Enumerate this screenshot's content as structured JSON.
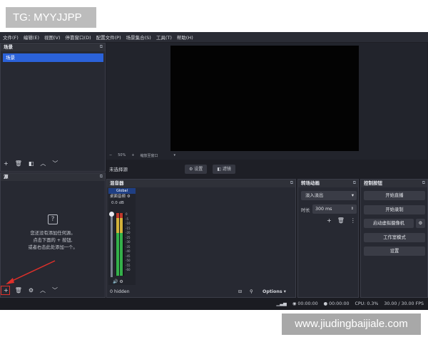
{
  "overlay": {
    "tag": "TG: MYYJJPP",
    "url": "www.jiudingbaijiale.com"
  },
  "menu": [
    "文件(F)",
    "编辑(E)",
    "视图(V)",
    "停靠窗口(D)",
    "配置文件(P)",
    "场景集合(S)",
    "工具(T)",
    "帮助(H)"
  ],
  "scenes": {
    "title": "场景",
    "items": [
      "场景"
    ]
  },
  "sources": {
    "title": "源",
    "empty_lines": [
      "您还没有添加任何源。",
      "点击下面的 + 按钮,",
      "或者右击此处添加一个。"
    ]
  },
  "preview": {
    "zoom": "50%",
    "scale_label": "缩放至窗口"
  },
  "source_bar": {
    "no_source": "未选择源",
    "settings": "设置",
    "filters": "滤镜"
  },
  "mixer": {
    "title": "混音器",
    "track": "Global",
    "channel_name": "桌面音频",
    "level": "0.0 dB",
    "scale": [
      "0",
      "-5",
      "-10",
      "-15",
      "-20",
      "-25",
      "-30",
      "-35",
      "-40",
      "-45",
      "-50",
      "-55",
      "-60"
    ],
    "hidden": "0 hidden",
    "options": "Options"
  },
  "transitions": {
    "title": "转场动画",
    "type": "淡入淡出",
    "duration_label": "时长",
    "duration": "300 ms"
  },
  "controls": {
    "title": "控制按钮",
    "start_stream": "开始直播",
    "start_record": "开始录制",
    "virtual_cam": "启动虚拟摄像机",
    "studio_mode": "工作室模式",
    "settings": "设置"
  },
  "status": {
    "stream_time": "00:00:00",
    "record_time": "00:00:00",
    "cpu": "CPU: 0.3%",
    "fps": "30.00 / 30.00 FPS"
  },
  "colors": {
    "accent": "#2b62d9",
    "annotation": "#e0302a"
  }
}
